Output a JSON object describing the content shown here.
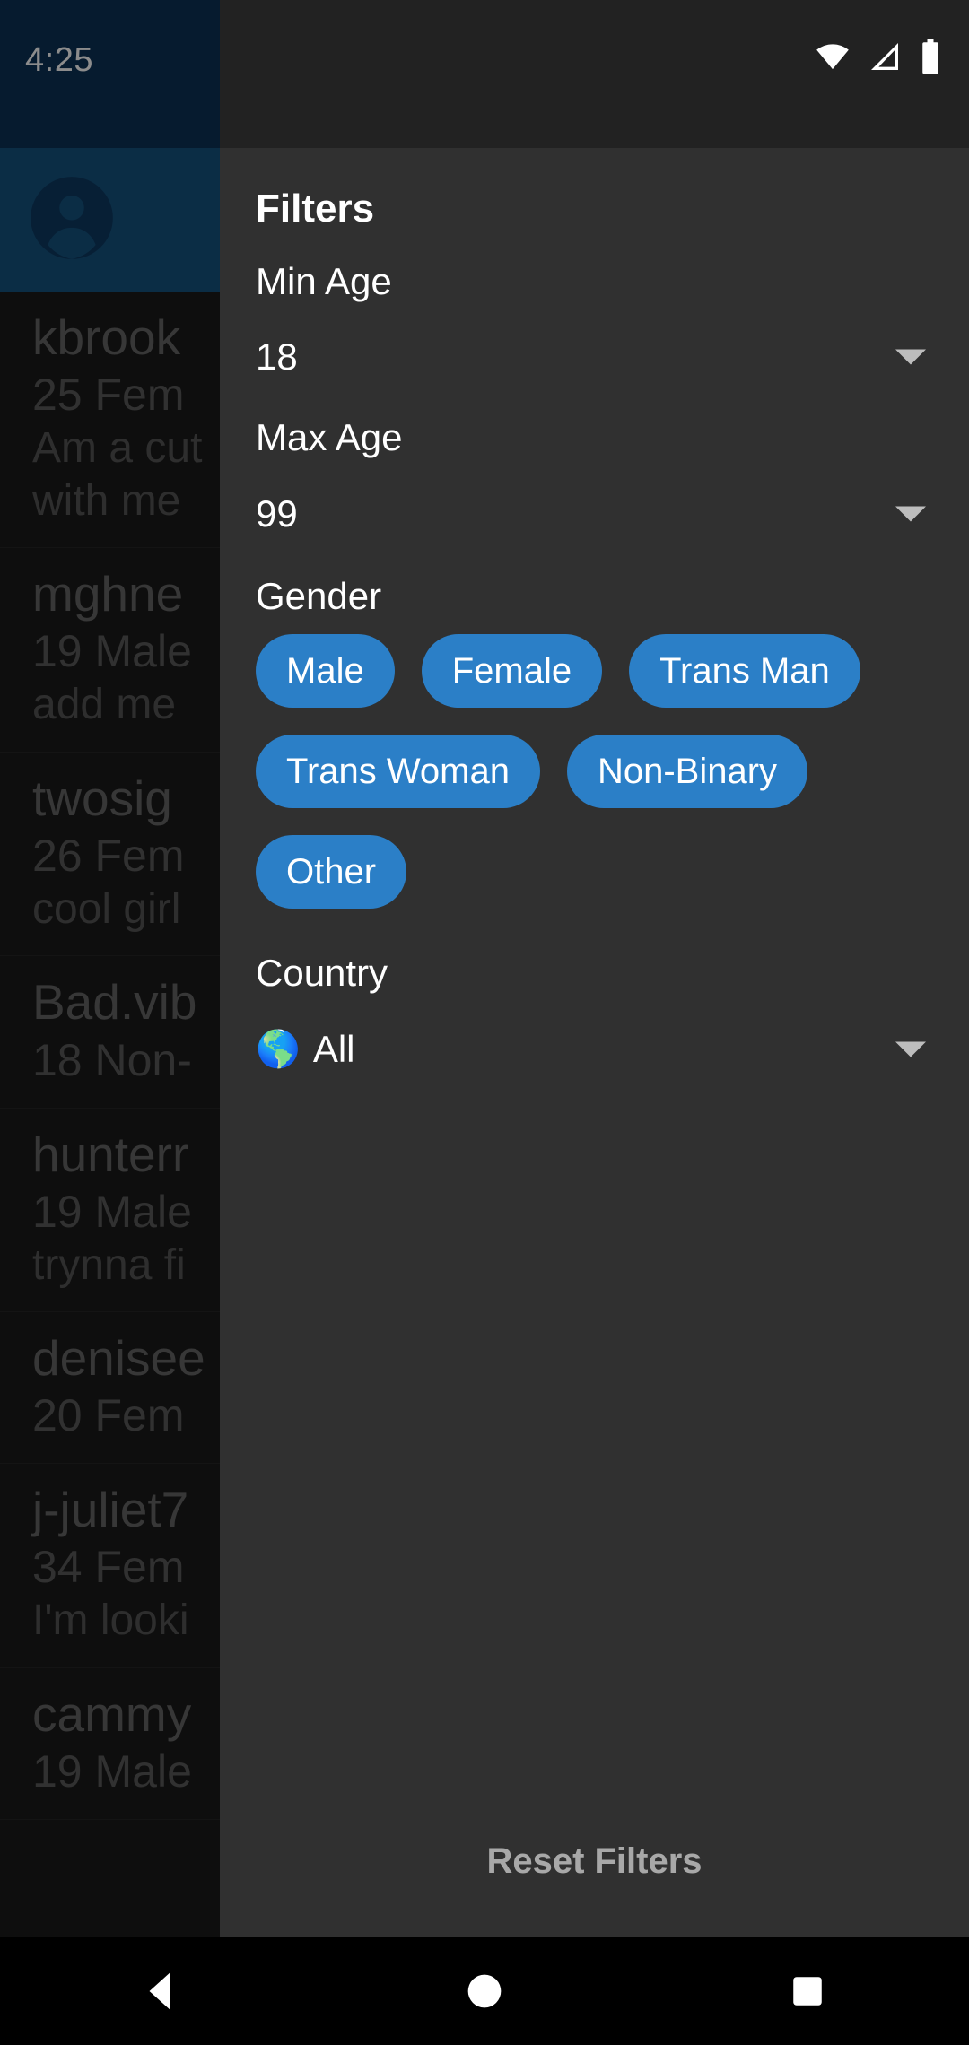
{
  "status_bar": {
    "time": "4:25",
    "icons": [
      "wifi-icon",
      "cellular-signal-icon",
      "battery-icon"
    ]
  },
  "background_app": {
    "appbar": {
      "avatar_icon": "person-avatar-icon"
    },
    "list": [
      {
        "name": "kbrook",
        "meta": "25 Fem",
        "bio": "Am a cut",
        "bio2": "with me"
      },
      {
        "name": "mghne",
        "meta": "19 Male",
        "bio": "add me",
        "bio2": ""
      },
      {
        "name": "twosig",
        "meta": "26 Fem",
        "bio": "cool girl",
        "bio2": ""
      },
      {
        "name": "Bad.vib",
        "meta": "18 Non-",
        "bio": "",
        "bio2": ""
      },
      {
        "name": "hunterr",
        "meta": "19 Male",
        "bio": "trynna fi",
        "bio2": ""
      },
      {
        "name": "denisee",
        "meta": "20 Fem",
        "bio": "",
        "bio2": ""
      },
      {
        "name": "j-juliet7",
        "meta": "34 Fem",
        "bio": "I'm looki",
        "bio2": ""
      },
      {
        "name": "cammy",
        "meta": "19 Male",
        "bio": "",
        "bio2": ""
      }
    ]
  },
  "filters_panel": {
    "title": "Filters",
    "min_age": {
      "label": "Min Age",
      "value": "18"
    },
    "max_age": {
      "label": "Max Age",
      "value": "99"
    },
    "gender": {
      "label": "Gender",
      "options": [
        "Male",
        "Female",
        "Trans Man",
        "Trans Woman",
        "Non-Binary",
        "Other"
      ]
    },
    "country": {
      "label": "Country",
      "value": "All",
      "icon": "globe-americas-icon",
      "glyph": "🌎"
    },
    "reset_label": "Reset Filters"
  },
  "nav_bar": {
    "back": "back-button",
    "home": "home-button",
    "recents": "recents-button"
  },
  "colors": {
    "panel_bg": "#303030",
    "chip_blue": "#2b7fc7",
    "appbar_blue": "#15527f",
    "statusbar_blue": "#0b3257",
    "reset_text": "#a8a8a8"
  }
}
